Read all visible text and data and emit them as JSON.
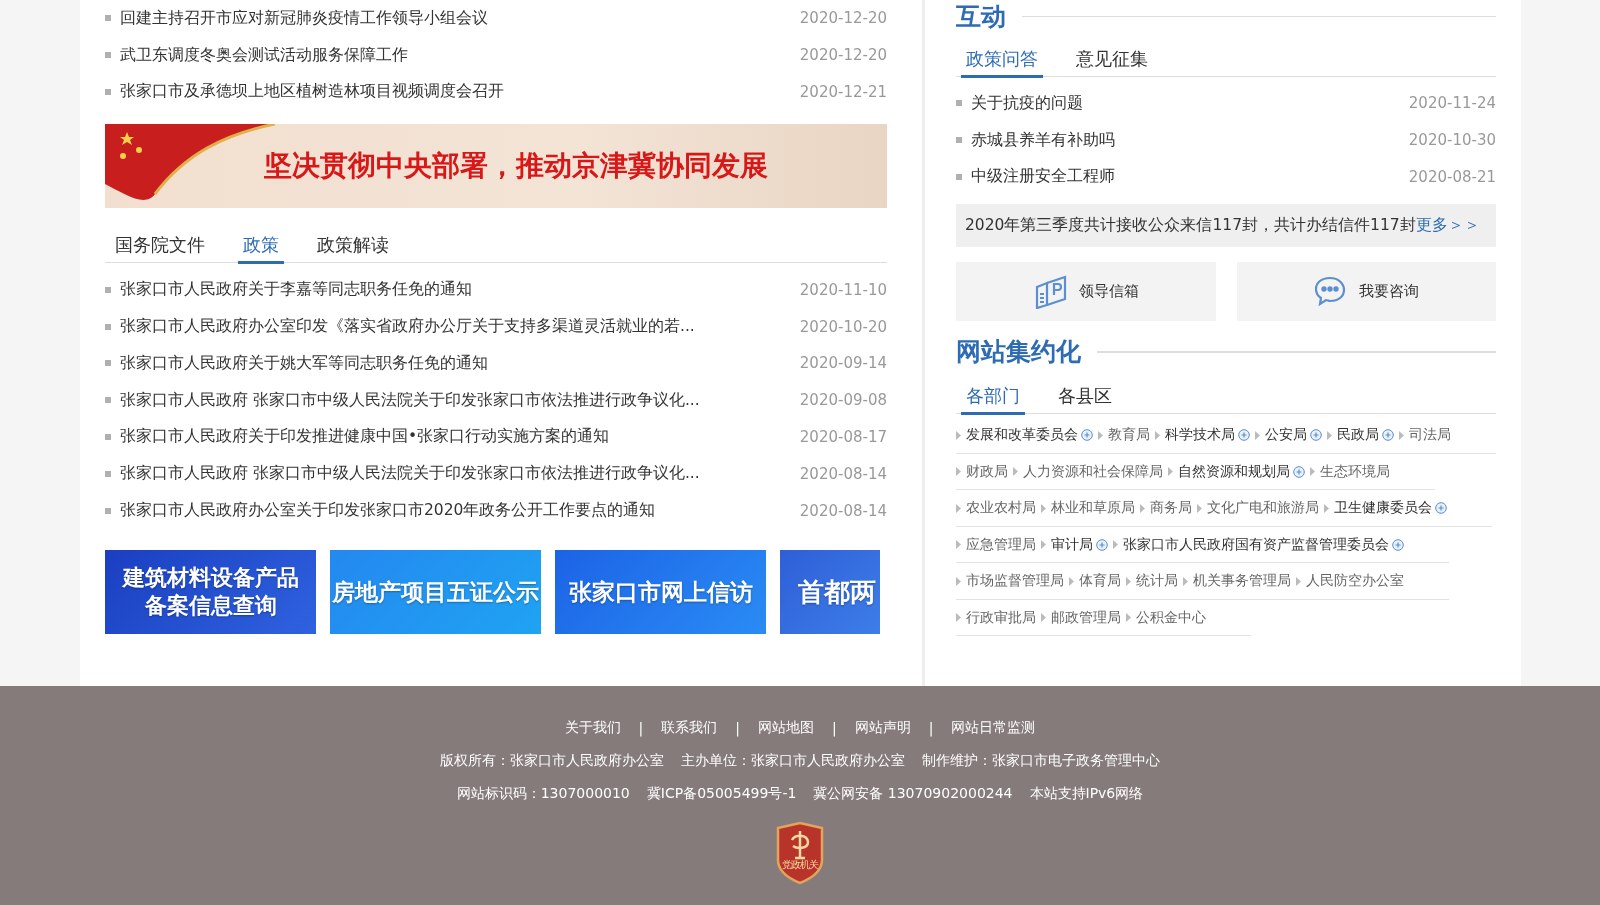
{
  "top_news": [
    {
      "title": "回建主持召开市应对新冠肺炎疫情工作领导小组会议",
      "date": "2020-12-20"
    },
    {
      "title": "武卫东调度冬奥会测试活动服务保障工作",
      "date": "2020-12-20"
    },
    {
      "title": "张家口市及承德坝上地区植树造林项目视频调度会召开",
      "date": "2020-12-21"
    }
  ],
  "slogan_banner": {
    "text": "坚决贯彻中央部署，推动京津冀协同发展"
  },
  "policy_tabs": [
    {
      "label": "国务院文件",
      "selected": false
    },
    {
      "label": "政策",
      "selected": true
    },
    {
      "label": "政策解读",
      "selected": false
    }
  ],
  "policy_news": [
    {
      "title": "张家口市人民政府关于李嘉等同志职务任免的通知",
      "date": "2020-11-10"
    },
    {
      "title": "张家口市人民政府办公室印发《落实省政府办公厅关于支持多渠道灵活就业的若...",
      "date": "2020-10-20"
    },
    {
      "title": "张家口市人民政府关于姚大军等同志职务任免的通知",
      "date": "2020-09-14"
    },
    {
      "title": "张家口市人民政府 张家口市中级人民法院关于印发张家口市依法推进行政争议化...",
      "date": "2020-09-08"
    },
    {
      "title": "张家口市人民政府关于印发推进健康中国•张家口行动实施方案的通知",
      "date": "2020-08-17"
    },
    {
      "title": "张家口市人民政府 张家口市中级人民法院关于印发张家口市依法推进行政争议化...",
      "date": "2020-08-14"
    },
    {
      "title": "张家口市人民政府办公室关于印发张家口市2020年政务公开工作要点的通知",
      "date": "2020-08-14"
    }
  ],
  "service_banners": [
    {
      "lines": [
        "建筑材料设备产品",
        "备案信息查询"
      ]
    },
    {
      "lines": [
        "房地产项目五证公示"
      ]
    },
    {
      "lines": [
        "张家口市网上信访"
      ]
    },
    {
      "lines": [
        "首都两"
      ]
    }
  ],
  "interaction": {
    "title": "互动",
    "tabs": [
      {
        "label": "政策问答",
        "selected": true
      },
      {
        "label": "意见征集",
        "selected": false
      }
    ],
    "items": [
      {
        "title": "关于抗疫的问题",
        "date": "2020-11-24"
      },
      {
        "title": "赤城县养羊有补助吗",
        "date": "2020-10-30"
      },
      {
        "title": "中级注册安全工程师",
        "date": "2020-08-21"
      }
    ],
    "notice": "2020年第三季度共计接收公众来信117封，共计办结信件117封",
    "more_link": "更多＞＞",
    "buttons": [
      {
        "kind": "mailbox",
        "label": "领导信箱"
      },
      {
        "kind": "chat",
        "label": "我要咨询"
      }
    ]
  },
  "intensive": {
    "title": "网站集约化",
    "tabs": [
      {
        "label": "各部门",
        "selected": true
      },
      {
        "label": "各县区",
        "selected": false
      }
    ],
    "rows": [
      {
        "links": [
          {
            "name": "发展和改革委员会",
            "badge": true
          },
          {
            "name": "教育局",
            "badge": false
          },
          {
            "name": "科学技术局",
            "badge": true
          },
          {
            "name": "公安局",
            "badge": true
          },
          {
            "name": "民政局",
            "badge": true
          },
          {
            "name": "司法局",
            "badge": false
          }
        ]
      },
      {
        "links": [
          {
            "name": "财政局",
            "badge": false
          },
          {
            "name": "人力资源和社会保障局",
            "badge": false
          },
          {
            "name": "自然资源和规划局",
            "badge": true
          },
          {
            "name": "生态环境局",
            "badge": false
          }
        ]
      },
      {
        "links": [
          {
            "name": "农业农村局",
            "badge": false
          },
          {
            "name": "林业和草原局",
            "badge": false
          },
          {
            "name": "商务局",
            "badge": false
          },
          {
            "name": "文化广电和旅游局",
            "badge": false
          },
          {
            "name": "卫生健康委员会",
            "badge": true
          }
        ]
      },
      {
        "links": [
          {
            "name": "应急管理局",
            "badge": false
          },
          {
            "name": "审计局",
            "badge": true
          },
          {
            "name": "张家口市人民政府国有资产监督管理委员会",
            "badge": true
          }
        ]
      },
      {
        "links": [
          {
            "name": "市场监督管理局",
            "badge": false
          },
          {
            "name": "体育局",
            "badge": false
          },
          {
            "name": "统计局",
            "badge": false
          },
          {
            "name": "机关事务管理局",
            "badge": false
          },
          {
            "name": "人民防空办公室",
            "badge": false
          }
        ]
      },
      {
        "links": [
          {
            "name": "行政审批局",
            "badge": false
          },
          {
            "name": "邮政管理局",
            "badge": false
          },
          {
            "name": "公积金中心",
            "badge": false
          }
        ]
      }
    ]
  },
  "footer": {
    "links": [
      "关于我们",
      "联系我们",
      "网站地图",
      "网站声明",
      "网站日常监测"
    ],
    "separator": "|",
    "info_lines": [
      [
        "版权所有：张家口市人民政府办公室",
        "主办单位：张家口市人民政府办公室",
        "制作维护：张家口市电子政务管理中心"
      ],
      [
        "网站标识码：1307000010",
        "冀ICP备05005499号-1",
        "冀公网安备 13070902000244",
        "本站支持IPv6网络"
      ]
    ],
    "emblem_text": "党政机关"
  }
}
